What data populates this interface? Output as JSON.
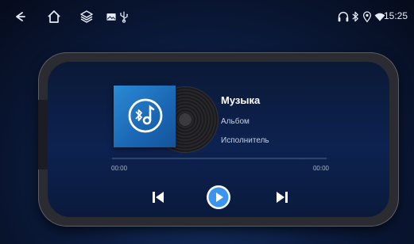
{
  "status_bar": {
    "icons": [
      "back-icon",
      "home-icon",
      "layers-icon",
      "image-icon",
      "usb-icon",
      "headset-icon",
      "bluetooth-icon",
      "location-icon",
      "wifi-icon"
    ],
    "time": "15:25"
  },
  "player": {
    "title": "Музыка",
    "album": "Альбом",
    "artist": "Исполнитель",
    "elapsed": "00:00",
    "total": "00:00",
    "progress": 0
  },
  "colors": {
    "accent": "#4aa3ff",
    "cover": "#2b8ad6",
    "background": "#0c1d42"
  }
}
